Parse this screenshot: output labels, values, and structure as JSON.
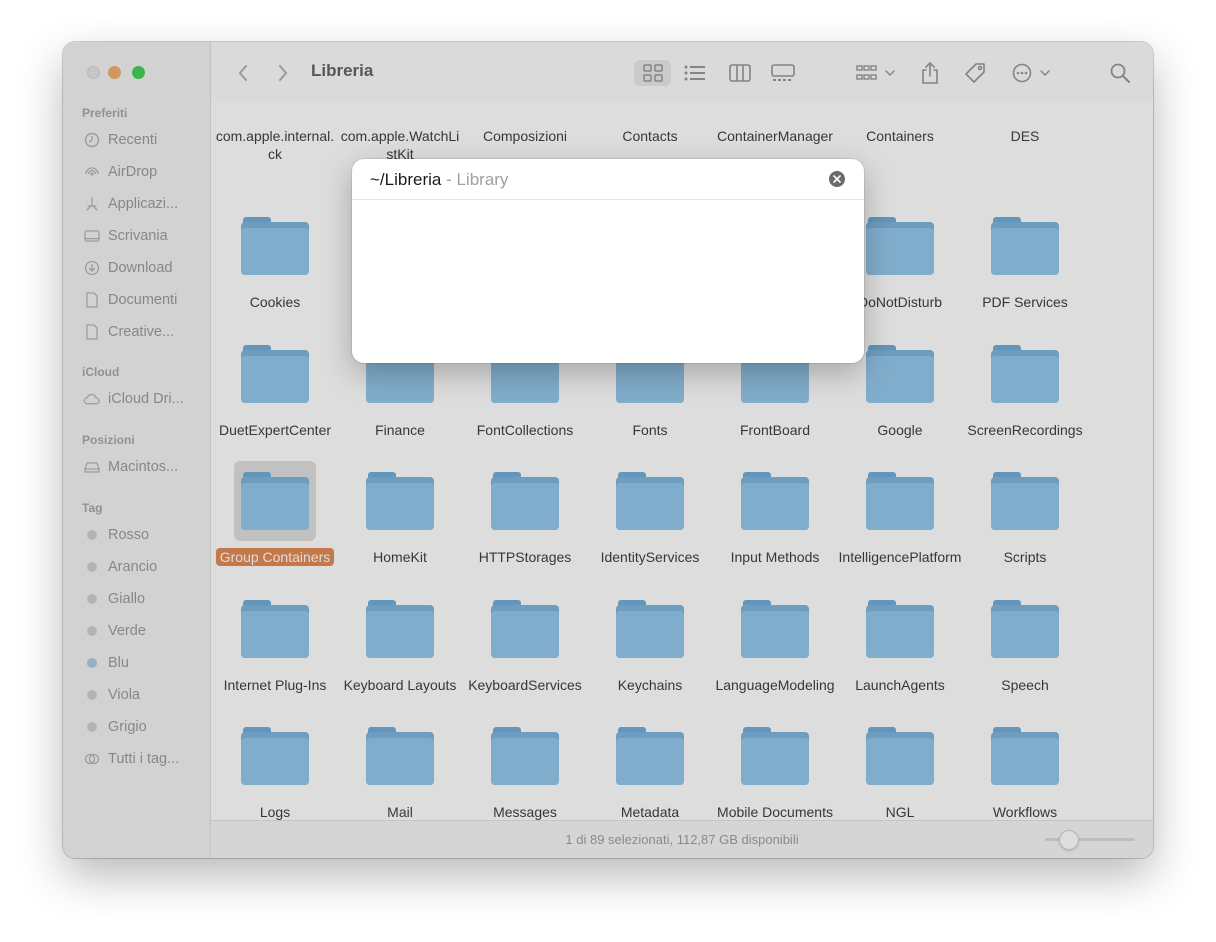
{
  "window": {
    "title": "Libreria"
  },
  "sidebar": {
    "sections": [
      {
        "title": "Preferiti",
        "items": [
          {
            "label": "Recenti",
            "icon": "clock-icon"
          },
          {
            "label": "AirDrop",
            "icon": "airdrop-icon"
          },
          {
            "label": "Applicazi...",
            "icon": "applications-icon"
          },
          {
            "label": "Scrivania",
            "icon": "desktop-icon"
          },
          {
            "label": "Download",
            "icon": "download-icon"
          },
          {
            "label": "Documenti",
            "icon": "document-icon"
          },
          {
            "label": "Creative...",
            "icon": "document-icon"
          }
        ]
      },
      {
        "title": "iCloud",
        "items": [
          {
            "label": "iCloud Dri...",
            "icon": "cloud-icon"
          }
        ]
      },
      {
        "title": "Posizioni",
        "items": [
          {
            "label": "Macintos...",
            "icon": "disk-icon"
          }
        ]
      },
      {
        "title": "Tag",
        "items": [
          {
            "label": "Rosso",
            "color": "#c8c8c8"
          },
          {
            "label": "Arancio",
            "color": "#c8c8c8"
          },
          {
            "label": "Giallo",
            "color": "#c8c8c8"
          },
          {
            "label": "Verde",
            "color": "#c8c8c8"
          },
          {
            "label": "Blu",
            "color": "#9ec3de"
          },
          {
            "label": "Viola",
            "color": "#c8c8c8"
          },
          {
            "label": "Grigio",
            "color": "#c8c8c8"
          },
          {
            "label": "Tutti i tag...",
            "icon": "all-tags-icon"
          }
        ]
      }
    ]
  },
  "toolbar": {
    "icons": [
      "back-icon",
      "forward-icon",
      "icon-view-icon",
      "list-view-icon",
      "column-view-icon",
      "gallery-view-icon",
      "group-icon",
      "share-icon",
      "tag-icon",
      "more-icon",
      "search-icon"
    ]
  },
  "folders": {
    "row0": [
      "com.apple.internal.ck",
      "com.apple.WatchListKit",
      "Composizioni",
      "Contacts",
      "ContainerManager",
      "Containers",
      "DES"
    ],
    "rows": [
      [
        "Cookies",
        "",
        "",
        "",
        "",
        "DoNotDisturb",
        "PDF Services"
      ],
      [
        "DuetExpertCenter",
        "Finance",
        "FontCollections",
        "Fonts",
        "FrontBoard",
        "Google",
        "ScreenRecordings"
      ],
      [
        "Group Containers",
        "HomeKit",
        "HTTPStorages",
        "IdentityServices",
        "Input Methods",
        "IntelligencePlatform",
        "Scripts"
      ],
      [
        "Internet Plug-Ins",
        "Keyboard Layouts",
        "KeyboardServices",
        "Keychains",
        "LanguageModeling",
        "LaunchAgents",
        "Speech"
      ],
      [
        "Logs",
        "Mail",
        "Messages",
        "Metadata",
        "Mobile Documents",
        "NGL",
        "Workflows"
      ]
    ],
    "selected": "Group Containers"
  },
  "status": {
    "text": "1 di 89 selezionati, 112,87 GB disponibili"
  },
  "dialog": {
    "value": "~/Libreria",
    "hint": " - Library"
  }
}
